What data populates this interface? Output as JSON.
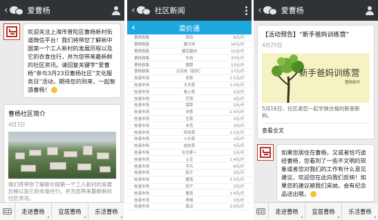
{
  "phone1": {
    "title": "爱曹杨",
    "welcome": "欢迎关注上海市普陀区曹杨新村街道微信平台！我们将带您了解新中国第一个工人新村的发展历程以及它的衣食住行，并为您带来最新鲜的社区资讯。请回复关键字“爱曹杨”参与3月23日曹杨社区“文化服务日”活动，期待您的到来，一起智游曹杨！",
    "card": {
      "title": "曹杨社区简介",
      "date": "4月3日",
      "desc": "我们将带你了解新中国第一个工人新村的发展历程以及它的衣食住行，并为您带来最新鲜的社区资讯。"
    },
    "menu": [
      "走进曹杨",
      "宜居曹杨",
      "乐活曹杨"
    ]
  },
  "phone2": {
    "title": "社区新闻",
    "page_title": "菜价通",
    "rows": [
      [
        "曹杨铁路",
        "草鸡",
        "6元/斤"
      ],
      [
        "曹杨铁路",
        "猪大排",
        "16元/斤"
      ],
      [
        "曹杨铁路",
        "猪后腿肉",
        "15元/斤"
      ],
      [
        "曹杨铁路",
        "牛肉",
        "37元/斤"
      ],
      [
        "曹杨铁路",
        "猪蹄",
        "12元/斤"
      ],
      [
        "曹杨铁路",
        "五花肉（助农）",
        "17元/斤"
      ],
      [
        "桂巷市场",
        "青菜",
        "1.5元/斤"
      ],
      [
        "桂巷市场",
        "大白菜",
        "1.2元/斤"
      ],
      [
        "桂巷市场",
        "卷心菜",
        "1元/斤"
      ],
      [
        "桂巷市场",
        "芹菜",
        "3元/斤"
      ],
      [
        "桂巷市场",
        "菠菜",
        "2元/斤"
      ],
      [
        "桂巷市场",
        "洋葱",
        "2.5元/斤"
      ],
      [
        "桂巷市场",
        "生菜",
        "3元/斤"
      ],
      [
        "桂巷市场",
        "米苋",
        "3元/斤"
      ],
      [
        "桂巷市场",
        "鸡毛菜",
        "2.5元/斤"
      ],
      [
        "桂巷市场",
        "小白菜",
        "2元/斤"
      ],
      [
        "桂巷市场",
        "娃娃菜",
        "3元/斤"
      ],
      [
        "桂巷市场",
        "长白萝卜",
        "1元/斤"
      ],
      [
        "桂巷市场",
        "土豆",
        "1.4元/斤"
      ],
      [
        "桂巷市场",
        "芋艿",
        "6元/斤"
      ],
      [
        "桂巷市场",
        "茄子",
        "3元/斤"
      ],
      [
        "桂巷市场",
        "番茄",
        "2.5元/斤"
      ],
      [
        "桂巷市场",
        "茄子",
        "3元/斤"
      ],
      [
        "桂巷市场",
        "番茄",
        "2.5元/斤"
      ],
      [
        "桂巷市场",
        "青椒",
        "3元/斤"
      ],
      [
        "桂巷市场",
        "黄瓜",
        "2.5元/斤"
      ]
    ]
  },
  "phone3": {
    "title": "爱曹杨",
    "card": {
      "title": "【活动预告】“新手爸妈训练营”",
      "date": "4月25日",
      "poster_text": "新手爸妈训练营",
      "poster_sub": "曹杨新村",
      "desc": "5月16日，社区邀您一起学做合格的新爸新妈。",
      "more": "查看全文"
    },
    "reply": "如果您居住在曹杨，又或者恰巧途经曹杨，您看到了一些不文明的现象或者您对我们的工作有什么意见建议，欢迎您在此向我们反映！如果您的建议被我们采纳，会有纪念品送出哦，",
    "menu": [
      "走进曹杨",
      "宜居曹杨",
      "乐活曹杨"
    ]
  },
  "colors": {
    "topbar": "#2f3335",
    "accent_blue": "#1fa8e0",
    "seal_red": "#b03025"
  },
  "icons": [
    "wechat-icon",
    "person-icon",
    "more-icon",
    "back-icon",
    "keyboard-icon",
    "seal-avatar-icon",
    "smile-emoji-icon"
  ]
}
